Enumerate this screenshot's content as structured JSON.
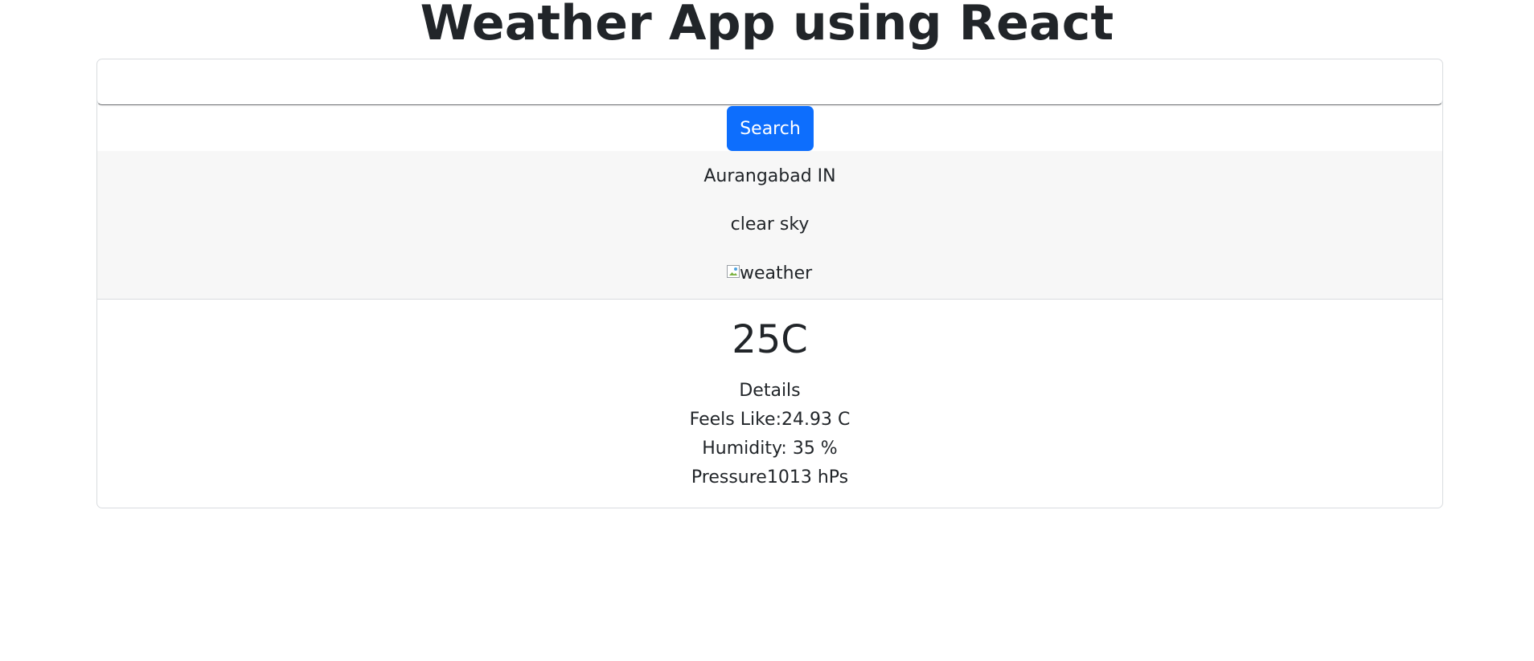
{
  "app": {
    "title": "Weather App using React"
  },
  "search": {
    "value": "",
    "placeholder": "",
    "button_label": "Search"
  },
  "weather": {
    "location": "Aurangabad IN",
    "description": "clear sky",
    "image_alt": "weather",
    "temperature": "25C",
    "details_heading": "Details",
    "feels_like": "Feels Like:24.93 C",
    "humidity": "Humidity: 35 %",
    "pressure": "Pressure1013 hPs"
  },
  "colors": {
    "primary_button": "#0d6efd",
    "header_background": "#f7f7f7",
    "text": "#212529"
  }
}
